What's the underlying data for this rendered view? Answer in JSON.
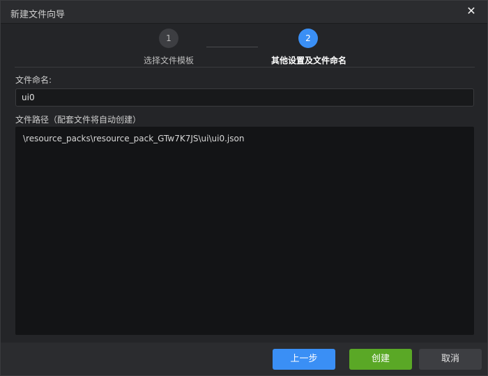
{
  "window": {
    "title": "新建文件向导",
    "close_glyph": "✕"
  },
  "steps": [
    {
      "number": "1",
      "label": "选择文件模板",
      "state": "done"
    },
    {
      "number": "2",
      "label": "其他设置及文件命名",
      "state": "active"
    }
  ],
  "form": {
    "name_label": "文件命名:",
    "name_value": "ui0",
    "path_label": "文件路径（配套文件将自动创建）",
    "path_value": "\\resource_packs\\resource_pack_GTw7K7JS\\ui\\ui0.json"
  },
  "buttons": {
    "prev": "上一步",
    "create": "创建",
    "cancel": "取消"
  },
  "colors": {
    "accent": "#3a8ff5",
    "create": "#5aa826",
    "background": "#242528"
  }
}
